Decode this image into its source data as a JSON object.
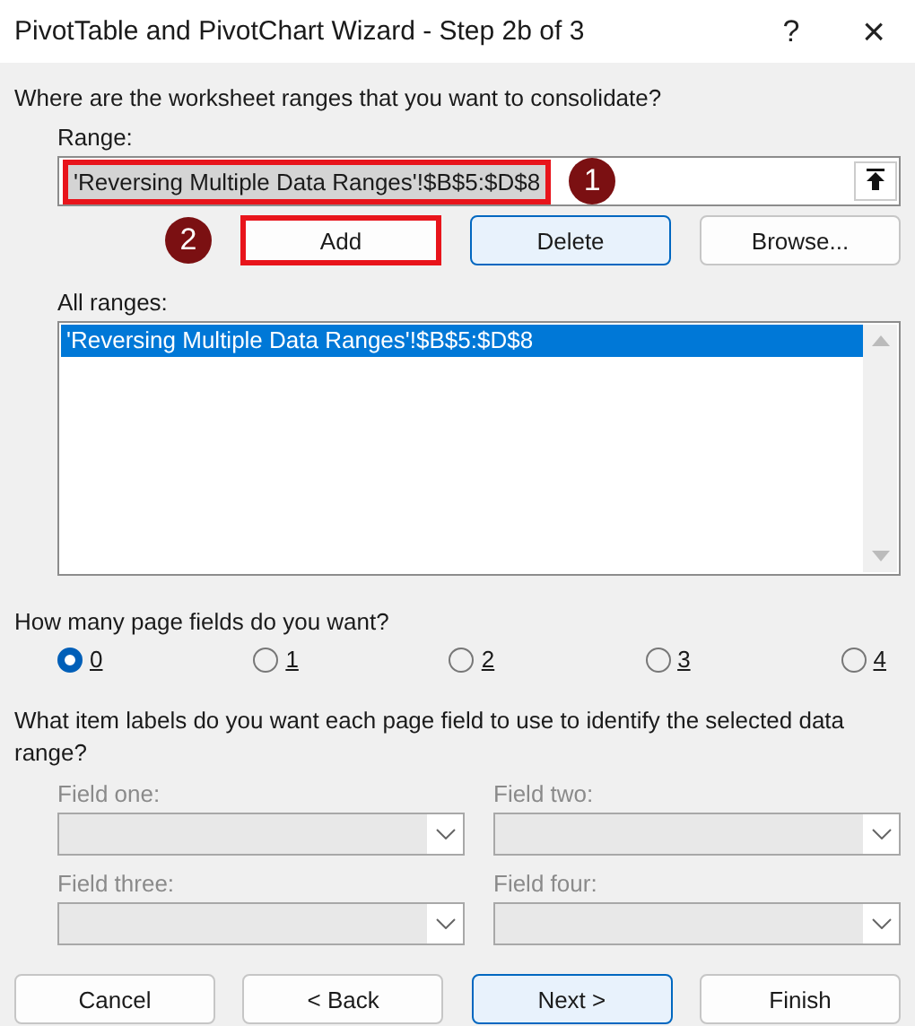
{
  "window": {
    "title": "PivotTable and PivotChart Wizard - Step 2b of 3",
    "title_buttons": [
      {
        "kind": "help",
        "label": "?"
      },
      {
        "kind": "close",
        "label": "×"
      }
    ]
  },
  "prompt": "Where are the worksheet ranges that you want to consolidate?",
  "range": {
    "label": "Range:",
    "value": "'Reversing Multiple Data Ranges'!$B$5:$D$8",
    "highlighted": true,
    "callout": "1"
  },
  "range_buttons": [
    {
      "label": "Add",
      "default": false,
      "callout": "2"
    },
    {
      "label": "Delete",
      "default": true
    },
    {
      "label": "Browse...",
      "default": false
    }
  ],
  "all_ranges": {
    "label": "All ranges:",
    "items": [
      {
        "text": "'Reversing Multiple Data Ranges'!$B$5:$D$8",
        "selected": true
      }
    ]
  },
  "page_fields": {
    "question": "How many page fields do you want?",
    "options": [
      {
        "label": "0",
        "selected": true
      },
      {
        "label": "1",
        "selected": false
      },
      {
        "label": "2",
        "selected": false
      },
      {
        "label": "3",
        "selected": false
      },
      {
        "label": "4",
        "selected": false
      }
    ]
  },
  "item_labels": {
    "question": "What item labels do you want each page field to use to identify the selected data range?",
    "fields": [
      {
        "label": "Field one:",
        "disabled": true
      },
      {
        "label": "Field two:",
        "disabled": true
      },
      {
        "label": "Field three:",
        "disabled": true
      },
      {
        "label": "Field four:",
        "disabled": true
      }
    ]
  },
  "buttons": [
    {
      "label": "Cancel",
      "default": false
    },
    {
      "label": "< Back",
      "default": false
    },
    {
      "label": "Next >",
      "default": true
    },
    {
      "label": "Finish",
      "default": false
    }
  ]
}
